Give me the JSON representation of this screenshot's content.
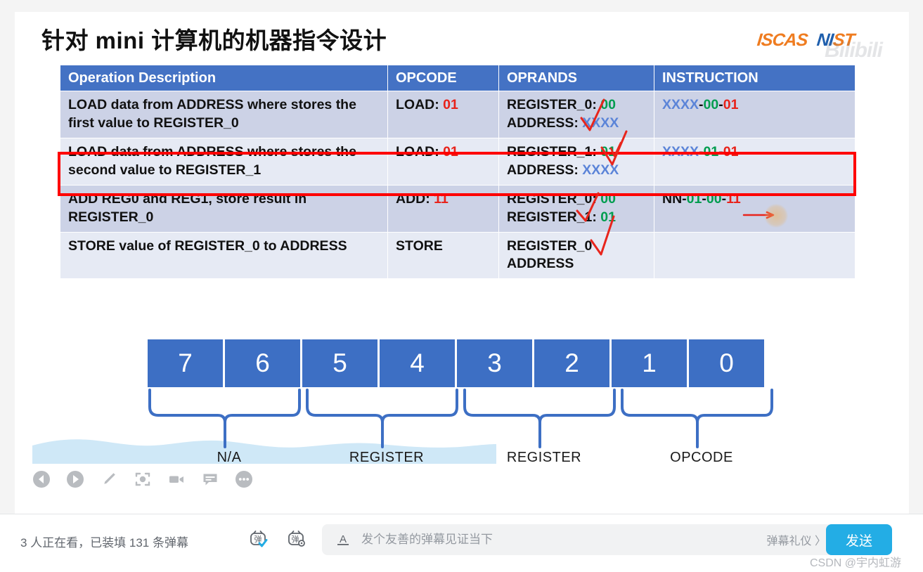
{
  "slide": {
    "title": "针对 mini 计算机的机器指令设计",
    "logos": {
      "iscas": "ISCAS",
      "nist_part1": "NI",
      "nist_part2": "ST",
      "bilibili_watermark": "Bilibili"
    },
    "table": {
      "headers": [
        "Operation Description",
        "OPCODE",
        "OPRANDS",
        "INSTRUCTION"
      ],
      "rows": [
        {
          "description": "LOAD data from ADDRESS where stores the first value to REGISTER_0",
          "opcode_label": "LOAD:",
          "opcode_value": "01",
          "operands": [
            {
              "label": "REGISTER_0:",
              "value": "00",
              "color": "green"
            },
            {
              "label": "ADDRESS:",
              "value": "XXXX",
              "color": "blue"
            }
          ],
          "instruction": [
            {
              "text": "XXXX",
              "color": "blue"
            },
            {
              "text": "-",
              "color": "black"
            },
            {
              "text": "00",
              "color": "green"
            },
            {
              "text": "-",
              "color": "black"
            },
            {
              "text": "01",
              "color": "red"
            }
          ],
          "highlighted": false
        },
        {
          "description": "LOAD data from ADDRESS where stores the second value to REGISTER_1",
          "opcode_label": "LOAD:",
          "opcode_value": "01",
          "operands": [
            {
              "label": "REGISTER_1:",
              "value": "01",
              "color": "green"
            },
            {
              "label": "ADDRESS:",
              "value": "XXXX",
              "color": "blue"
            }
          ],
          "instruction": [
            {
              "text": "XXXX",
              "color": "blue"
            },
            {
              "text": "-",
              "color": "black"
            },
            {
              "text": "01",
              "color": "green"
            },
            {
              "text": "-",
              "color": "black"
            },
            {
              "text": "01",
              "color": "red"
            }
          ],
          "highlighted": false
        },
        {
          "description": "ADD REG0 and REG1, store result in REGISTER_0",
          "opcode_label": "ADD:",
          "opcode_value": "11",
          "operands": [
            {
              "label": "REGISTER_0:",
              "value": "00",
              "color": "green"
            },
            {
              "label": "REGISTER_1:",
              "value": "01",
              "color": "green"
            }
          ],
          "instruction": [
            {
              "text": "NN",
              "color": "black"
            },
            {
              "text": "-",
              "color": "black"
            },
            {
              "text": "01",
              "color": "green"
            },
            {
              "text": "-",
              "color": "black"
            },
            {
              "text": "00",
              "color": "green"
            },
            {
              "text": "-",
              "color": "black"
            },
            {
              "text": "11",
              "color": "red"
            }
          ],
          "highlighted": true
        },
        {
          "description": "STORE value of REGISTER_0 to ADDRESS",
          "opcode_label": "STORE",
          "opcode_value": "",
          "operands": [
            {
              "label": "REGISTER_0",
              "value": "",
              "color": "black"
            },
            {
              "label": "ADDRESS",
              "value": "",
              "color": "black"
            }
          ],
          "instruction": [],
          "highlighted": false
        }
      ]
    },
    "bit_diagram": {
      "bits": [
        "7",
        "6",
        "5",
        "4",
        "3",
        "2",
        "1",
        "0"
      ],
      "field_labels": [
        "N/A",
        "REGISTER",
        "REGISTER",
        "OPCODE"
      ],
      "box_color": "#3d6fc4",
      "brace_color": "#3d6fc4"
    }
  },
  "player": {
    "icons": [
      {
        "name": "previous-icon",
        "label": "上一个"
      },
      {
        "name": "play-icon",
        "label": "播放"
      },
      {
        "name": "pencil-icon",
        "label": "笔记"
      },
      {
        "name": "screenshot-icon",
        "label": "截图"
      },
      {
        "name": "record-icon",
        "label": "录制"
      },
      {
        "name": "subtitle-icon",
        "label": "字幕"
      },
      {
        "name": "more-icon",
        "label": "更多"
      }
    ]
  },
  "bottom_bar": {
    "viewer_text": "3 人正在看，已装填 131 条弹幕",
    "viewer_count": "3",
    "danmu_count": "131",
    "danmu_toggle_label": "弹",
    "danmu_settings_label": "弹",
    "font_icon": "A",
    "input_placeholder": "发个友善的弹幕见证当下",
    "input_value": "",
    "etiquette_label": "弹幕礼仪 〉",
    "send_label": "发送",
    "send_color": "#23ade5"
  },
  "watermark": {
    "csdn": "CSDN @宇内虹游"
  }
}
